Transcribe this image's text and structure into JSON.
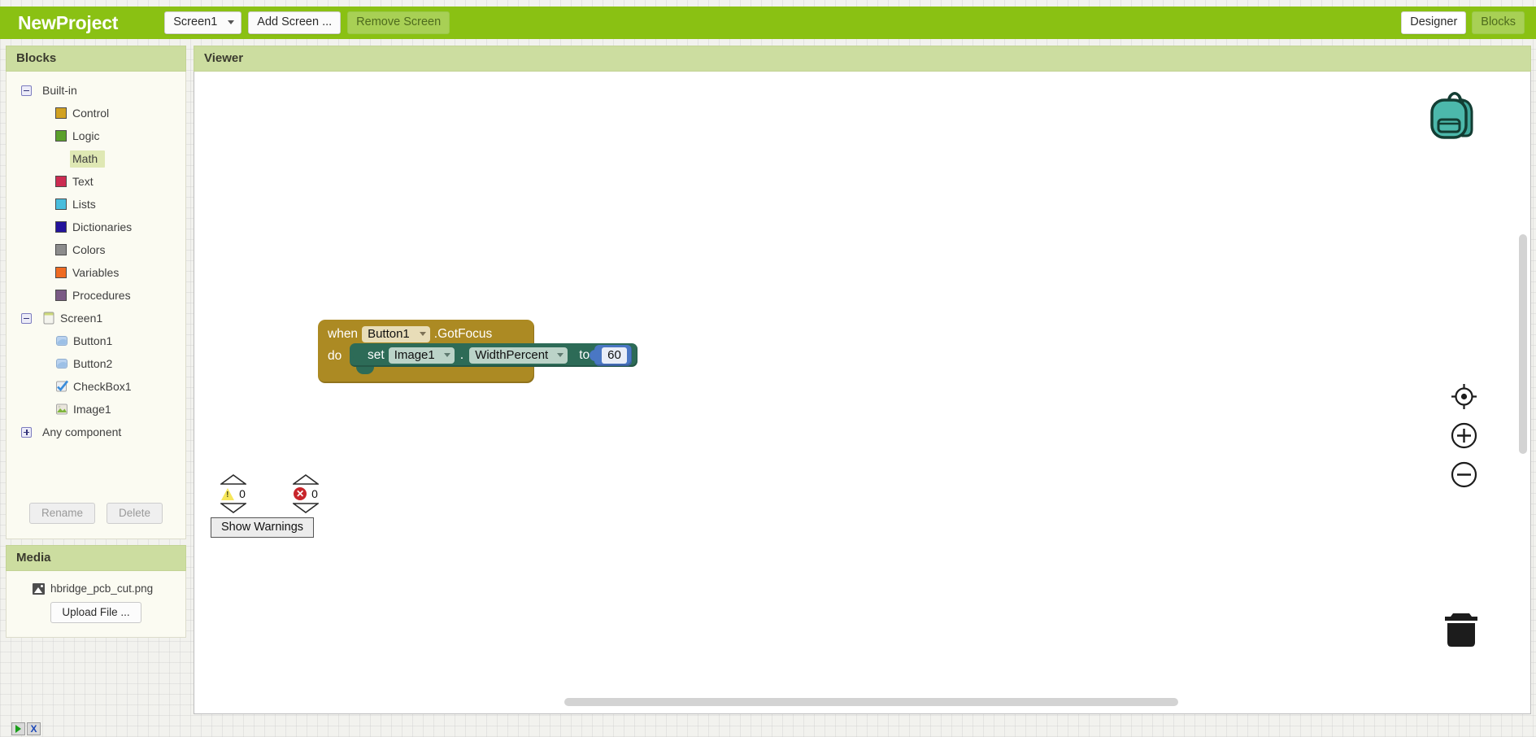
{
  "topbar": {
    "project_title": "NewProject",
    "screen_selector": "Screen1",
    "add_screen_label": "Add Screen ...",
    "remove_screen_label": "Remove Screen",
    "designer_label": "Designer",
    "blocks_label": "Blocks",
    "accent_color": "#8ac113"
  },
  "blocks_panel": {
    "header": "Blocks",
    "tree": [
      {
        "label": "Built-in",
        "level": 0,
        "expander": "minus",
        "icon": "none"
      },
      {
        "label": "Control",
        "level": 1,
        "icon": "swatch",
        "color": "#d1a122"
      },
      {
        "label": "Logic",
        "level": 1,
        "icon": "swatch",
        "color": "#5ba02c"
      },
      {
        "label": "Math",
        "level": 1,
        "icon": "swatch",
        "color": "#4a7fbd",
        "selected": true
      },
      {
        "label": "Text",
        "level": 1,
        "icon": "swatch",
        "color": "#cc2c52"
      },
      {
        "label": "Lists",
        "level": 1,
        "icon": "swatch",
        "color": "#49bddd"
      },
      {
        "label": "Dictionaries",
        "level": 1,
        "icon": "swatch",
        "color": "#23139c"
      },
      {
        "label": "Colors",
        "level": 1,
        "icon": "swatch",
        "color": "#8c8c8c"
      },
      {
        "label": "Variables",
        "level": 1,
        "icon": "swatch",
        "color": "#ef6b22"
      },
      {
        "label": "Procedures",
        "level": 1,
        "icon": "swatch",
        "color": "#7a5a85"
      },
      {
        "label": "Screen1",
        "level": 0,
        "expander": "minus",
        "icon": "screen"
      },
      {
        "label": "Button1",
        "level": 1,
        "icon": "button"
      },
      {
        "label": "Button2",
        "level": 1,
        "icon": "button"
      },
      {
        "label": "CheckBox1",
        "level": 1,
        "icon": "checkbox"
      },
      {
        "label": "Image1",
        "level": 1,
        "icon": "image"
      },
      {
        "label": "Any component",
        "level": 0,
        "expander": "plus",
        "icon": "none"
      }
    ],
    "rename_label": "Rename",
    "delete_label": "Delete"
  },
  "media_panel": {
    "header": "Media",
    "files": [
      "hbridge_pcb_cut.png"
    ],
    "upload_label": "Upload File ..."
  },
  "viewer": {
    "header": "Viewer",
    "blocks": {
      "event": {
        "when_kw": "when",
        "component": "Button1",
        "event_name": ".GotFocus",
        "do_kw": "do"
      },
      "setter": {
        "set_kw": "set",
        "component": "Image1",
        "separator": ".",
        "property": "WidthPercent",
        "to_kw": "to"
      },
      "value": {
        "number": "60"
      }
    },
    "warnings": {
      "warning_count": "0",
      "error_count": "0",
      "show_warnings_label": "Show Warnings"
    },
    "icons": {
      "backpack": "backpack-icon",
      "center": "center-workspace-icon",
      "zoom_in": "zoom-in-icon",
      "zoom_out": "zoom-out-icon",
      "trash": "trash-icon"
    }
  },
  "status_bar": {
    "run_chip": "run-icon",
    "close_chip": "X"
  }
}
